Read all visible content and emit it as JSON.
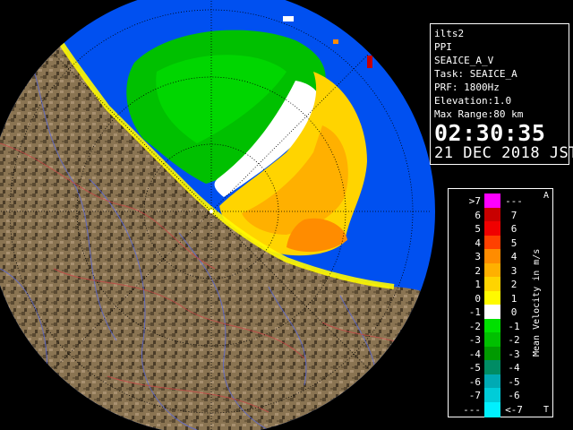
{
  "info": {
    "station": "ilts2",
    "scan_type": "PPI",
    "product": "SEAICE_A_V",
    "task": "Task: SEAICE_A",
    "prf": "PRF: 1800Hz",
    "elevation": "Elevation:1.0",
    "max_range": "Max Range:80 km",
    "time": "02:30:35",
    "date": "21 DEC 2018 JST"
  },
  "legend": {
    "title": "Mean Velocity in m/s",
    "top_marker": "A",
    "bottom_marker": "T",
    "rows": [
      {
        "left": ">7",
        "right": "---",
        "color": "#ff00ff"
      },
      {
        "left": "6",
        "right": "7",
        "color": "#c80000"
      },
      {
        "left": "5",
        "right": "6",
        "color": "#f00000"
      },
      {
        "left": "4",
        "right": "5",
        "color": "#ff4000"
      },
      {
        "left": "3",
        "right": "4",
        "color": "#ff8c00"
      },
      {
        "left": "2",
        "right": "3",
        "color": "#ffb000"
      },
      {
        "left": "1",
        "right": "2",
        "color": "#ffd400"
      },
      {
        "left": "0",
        "right": "1",
        "color": "#fffa00"
      },
      {
        "left": "-1",
        "right": "0",
        "color": "#ffffff"
      },
      {
        "left": "-2",
        "right": "-1",
        "color": "#00e000"
      },
      {
        "left": "-3",
        "right": "-2",
        "color": "#00c000"
      },
      {
        "left": "-4",
        "right": "-3",
        "color": "#009a00"
      },
      {
        "left": "-5",
        "right": "-4",
        "color": "#008c64"
      },
      {
        "left": "-6",
        "right": "-5",
        "color": "#00aab4"
      },
      {
        "left": "-7",
        "right": "-6",
        "color": "#00ccd8"
      },
      {
        "left": "---",
        "right": "<-7",
        "color": "#00f0ff"
      }
    ]
  },
  "colors": {
    "sea": "#0050f0",
    "land": "#8a7452",
    "land_dark": "#4a3c28",
    "range_ring": "#000000"
  }
}
